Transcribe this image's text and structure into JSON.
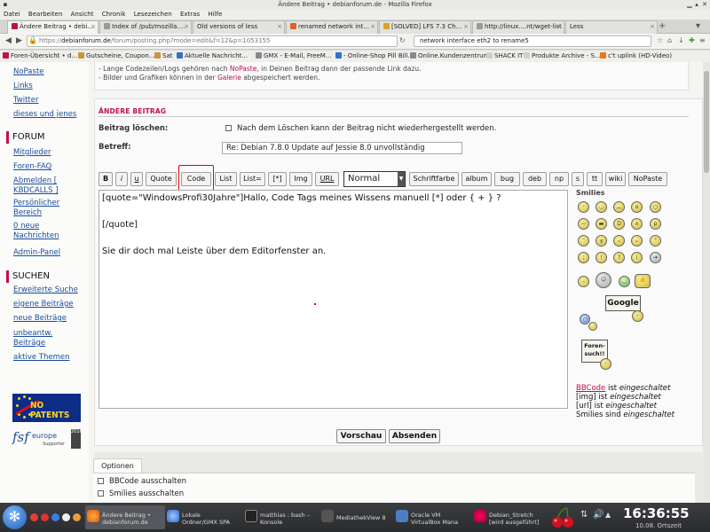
{
  "window": {
    "title": "Ändere Beitrag • debianforum.de - Mozilla Firefox"
  },
  "menu": [
    "Datei",
    "Bearbeiten",
    "Ansicht",
    "Chronik",
    "Lesezeichen",
    "Extras",
    "Hilfe"
  ],
  "tabs": [
    {
      "label": "Ändere Beitrag • debi...",
      "active": true
    },
    {
      "label": "Index of /pub/mozilla....",
      "active": false
    },
    {
      "label": "Old versions of less",
      "active": false
    },
    {
      "label": "renamed network int...",
      "active": false
    },
    {
      "label": "[SOLVED] LFS 7.3 Ch...",
      "active": false
    },
    {
      "label": "http://linux....nt/wget-list",
      "active": false
    },
    {
      "label": "Less",
      "active": false
    }
  ],
  "nav": {
    "url_prefix": "https://",
    "url_host": "debianforum.de",
    "url_path": "/forum/posting.php?mode=edit&f=12&p=1053155",
    "search": "network interface eth2 to rename5"
  },
  "bookmarks": [
    "Foren-Übersicht • d...",
    "Gutscheine, Coupon...",
    "Sat",
    "Aktuelle Nachricht...",
    "GMX - E-Mail, FreeM...",
    "- Online-Shop Pill Bill...",
    "Online.Kundenzentrum",
    "SHACK IT",
    "Produkte Archive - S...",
    "c't uplink (HD-Video)"
  ],
  "sidebar": {
    "top_links": [
      "NoPaste",
      "Links",
      "Twitter",
      "dieses und jenes"
    ],
    "forum_head": "FORUM",
    "forum_links": [
      "Mitglieder",
      "Foren-FAQ",
      "Abmelden [ KBDCALLS ]",
      "Persönlicher Bereich",
      "0 neue Nachrichten",
      "Admin-Panel"
    ],
    "search_head": "SUCHEN",
    "search_links": [
      "Erweiterte Suche",
      "eigene Beiträge",
      "neue Beiträge",
      "unbeantw. Beiträge",
      "aktive Themen"
    ],
    "logo1": "NO PATENTS",
    "logo2_main": "fsf",
    "logo2_eu": "europe",
    "logo2_sup": "Supporter",
    "logo2_block": "2016"
  },
  "hints": {
    "line1_a": "- Lange Codezeilen/Logs gehören nach ",
    "line1_link": "NoPaste",
    "line1_b": ", in Deinen Beitrag dann der passende Link dazu.",
    "line2_a": "- Bilder und Grafiken können in der ",
    "line2_link": "Galerie",
    "line2_b": " abgespeichert werden."
  },
  "form": {
    "section_title": "ÄNDERE BEITRAG",
    "delete_label": "Beitrag löschen:",
    "delete_note": "Nach dem Löschen kann der Beitrag nicht wiederhergestellt werden.",
    "subject_label": "Betreff:",
    "subject_value": "Re: Debian 7.8.0 Update auf Jessie 8.0 unvollständig",
    "toolbar": [
      "B",
      "i",
      "u",
      "Quote",
      "Code",
      "List",
      "List=",
      "[*]",
      "Img",
      "URL"
    ],
    "size_select": "Normal",
    "toolbar2": [
      "Schriftfarbe",
      "album",
      "bug",
      "deb",
      "np",
      "s",
      "tt",
      "wiki",
      "NoPaste"
    ],
    "editor_line1": "[quote=\"WindowsProfi30Jahre\"]Hallo, Code Tags meines Wissens manuell [*] oder { + } ?",
    "editor_line2": "[/quote]",
    "editor_line3": "Sie dir doch mal Leiste über dem Editorfenster an.",
    "preview": "Vorschau",
    "submit": "Absenden"
  },
  "smilies": {
    "title": "Smilies",
    "google": "Google",
    "forum_search": "Foren-such!!",
    "bbcode_link": "BBCode",
    "bbcode_is": " ist ",
    "bbcode_state": "eingeschaltet",
    "img_line": "[img] ist ",
    "url_line": "[url] ist ",
    "smilies_line": "Smilies sind "
  },
  "options": {
    "tab": "Optionen",
    "opt1": "BBCode ausschalten",
    "opt2": "Smilies ausschalten"
  },
  "taskbar": {
    "tasks": [
      {
        "label1": "Ändere Beitrag •",
        "label2": "debianforum.de"
      },
      {
        "label1": "Lokale",
        "label2": "Ordner/GMX SPA"
      },
      {
        "label1": "matthias : bash –",
        "label2": "Konsole"
      },
      {
        "label1": "MediathekView 8",
        "label2": ""
      },
      {
        "label1": "Oracle VM",
        "label2": "VirtualBox Mana"
      },
      {
        "label1": "Debian_Stretch",
        "label2": "[wird ausgeführt]"
      }
    ],
    "time": "16:36:55",
    "date": "10.08.  Ortszeit"
  },
  "colors": {
    "accent": "#c0104a",
    "link": "#1a4d9a",
    "highlight": "#e00000"
  }
}
